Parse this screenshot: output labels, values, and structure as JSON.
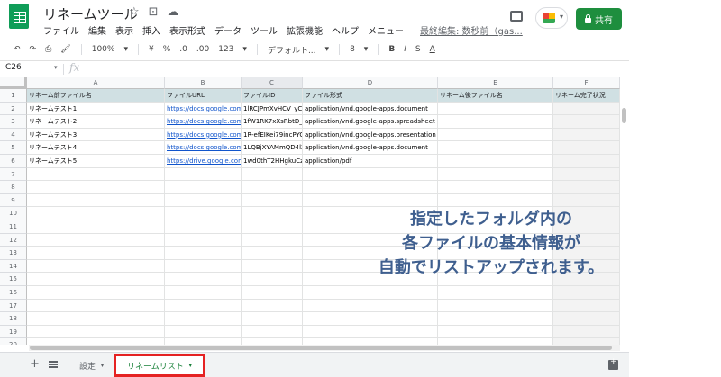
{
  "document": {
    "title": "リネームツール",
    "icons": [
      "star-icon",
      "folder-move-icon",
      "cloud-status-icon"
    ]
  },
  "menu": {
    "items": [
      "ファイル",
      "編集",
      "表示",
      "挿入",
      "表示形式",
      "データ",
      "ツール",
      "拡張機能",
      "ヘルプ",
      "メニュー"
    ],
    "last_edit": "最終編集: 数秒前（gas..."
  },
  "header_actions": {
    "share_label": "共有",
    "share_color": "#1e8e3e"
  },
  "toolbar": {
    "undo": "↶",
    "redo": "↷",
    "print": "⎙",
    "paint_format": "🖌",
    "zoom": "100%",
    "currency": "¥",
    "percent": "%",
    "decrease_decimal": ".0",
    "increase_decimal": ".00",
    "more_formats": "123",
    "font": "デフォルト...",
    "font_size": "8",
    "bold": "B",
    "italic": "I",
    "strikethrough": "S",
    "text_color": "A",
    "caret": "▾"
  },
  "formula_bar": {
    "cell_ref": "C26",
    "fx": "fx",
    "value": ""
  },
  "sheet": {
    "columns": [
      "A",
      "B",
      "C",
      "D",
      "E",
      "F"
    ],
    "rows": [
      [
        "リネーム前ファイル名",
        "ファイルURL",
        "ファイルID",
        "ファイル形式",
        "リネーム後ファイル名",
        "リネーム完了状況"
      ],
      [
        "リネームテスト1",
        "https://docs.google.com/do",
        "1lRCJPmXvHCV_yC",
        "application/vnd.google-apps.document",
        "",
        ""
      ],
      [
        "リネームテスト2",
        "https://docs.google.com/sp",
        "1fW1RK7xXsRbtD_L",
        "application/vnd.google-apps.spreadsheet",
        "",
        ""
      ],
      [
        "リネームテスト3",
        "https://docs.google.com/pr",
        "1R-efEIKei79incPYC",
        "application/vnd.google-apps.presentation",
        "",
        ""
      ],
      [
        "リネームテスト4",
        "https://docs.google.com/do",
        "1LQBjXYAMmQD4lZ",
        "application/vnd.google-apps.document",
        "",
        ""
      ],
      [
        "リネームテスト5",
        "https://drive.google.com/file",
        "1wd0thT2HHgkuCz\\",
        "application/pdf",
        "",
        ""
      ]
    ],
    "row_numbers": [
      "1",
      "2",
      "3",
      "4",
      "5",
      "6",
      "7",
      "8",
      "9",
      "10",
      "11",
      "12",
      "13",
      "14",
      "15",
      "16",
      "17",
      "18",
      "19",
      "20"
    ],
    "header_fill": "#d0e0e3",
    "link_color": "#1155cc"
  },
  "caption": {
    "lines": [
      "指定したフォルダ内の",
      "各ファイルの基本情報が",
      "自動でリストアップされます。"
    ],
    "color": "#3f5f8f"
  },
  "tabs": {
    "add": "+",
    "items": [
      {
        "label": "設定",
        "active": false
      },
      {
        "label": "リネームリスト",
        "active": true
      }
    ],
    "highlight_color": "#e52222"
  }
}
